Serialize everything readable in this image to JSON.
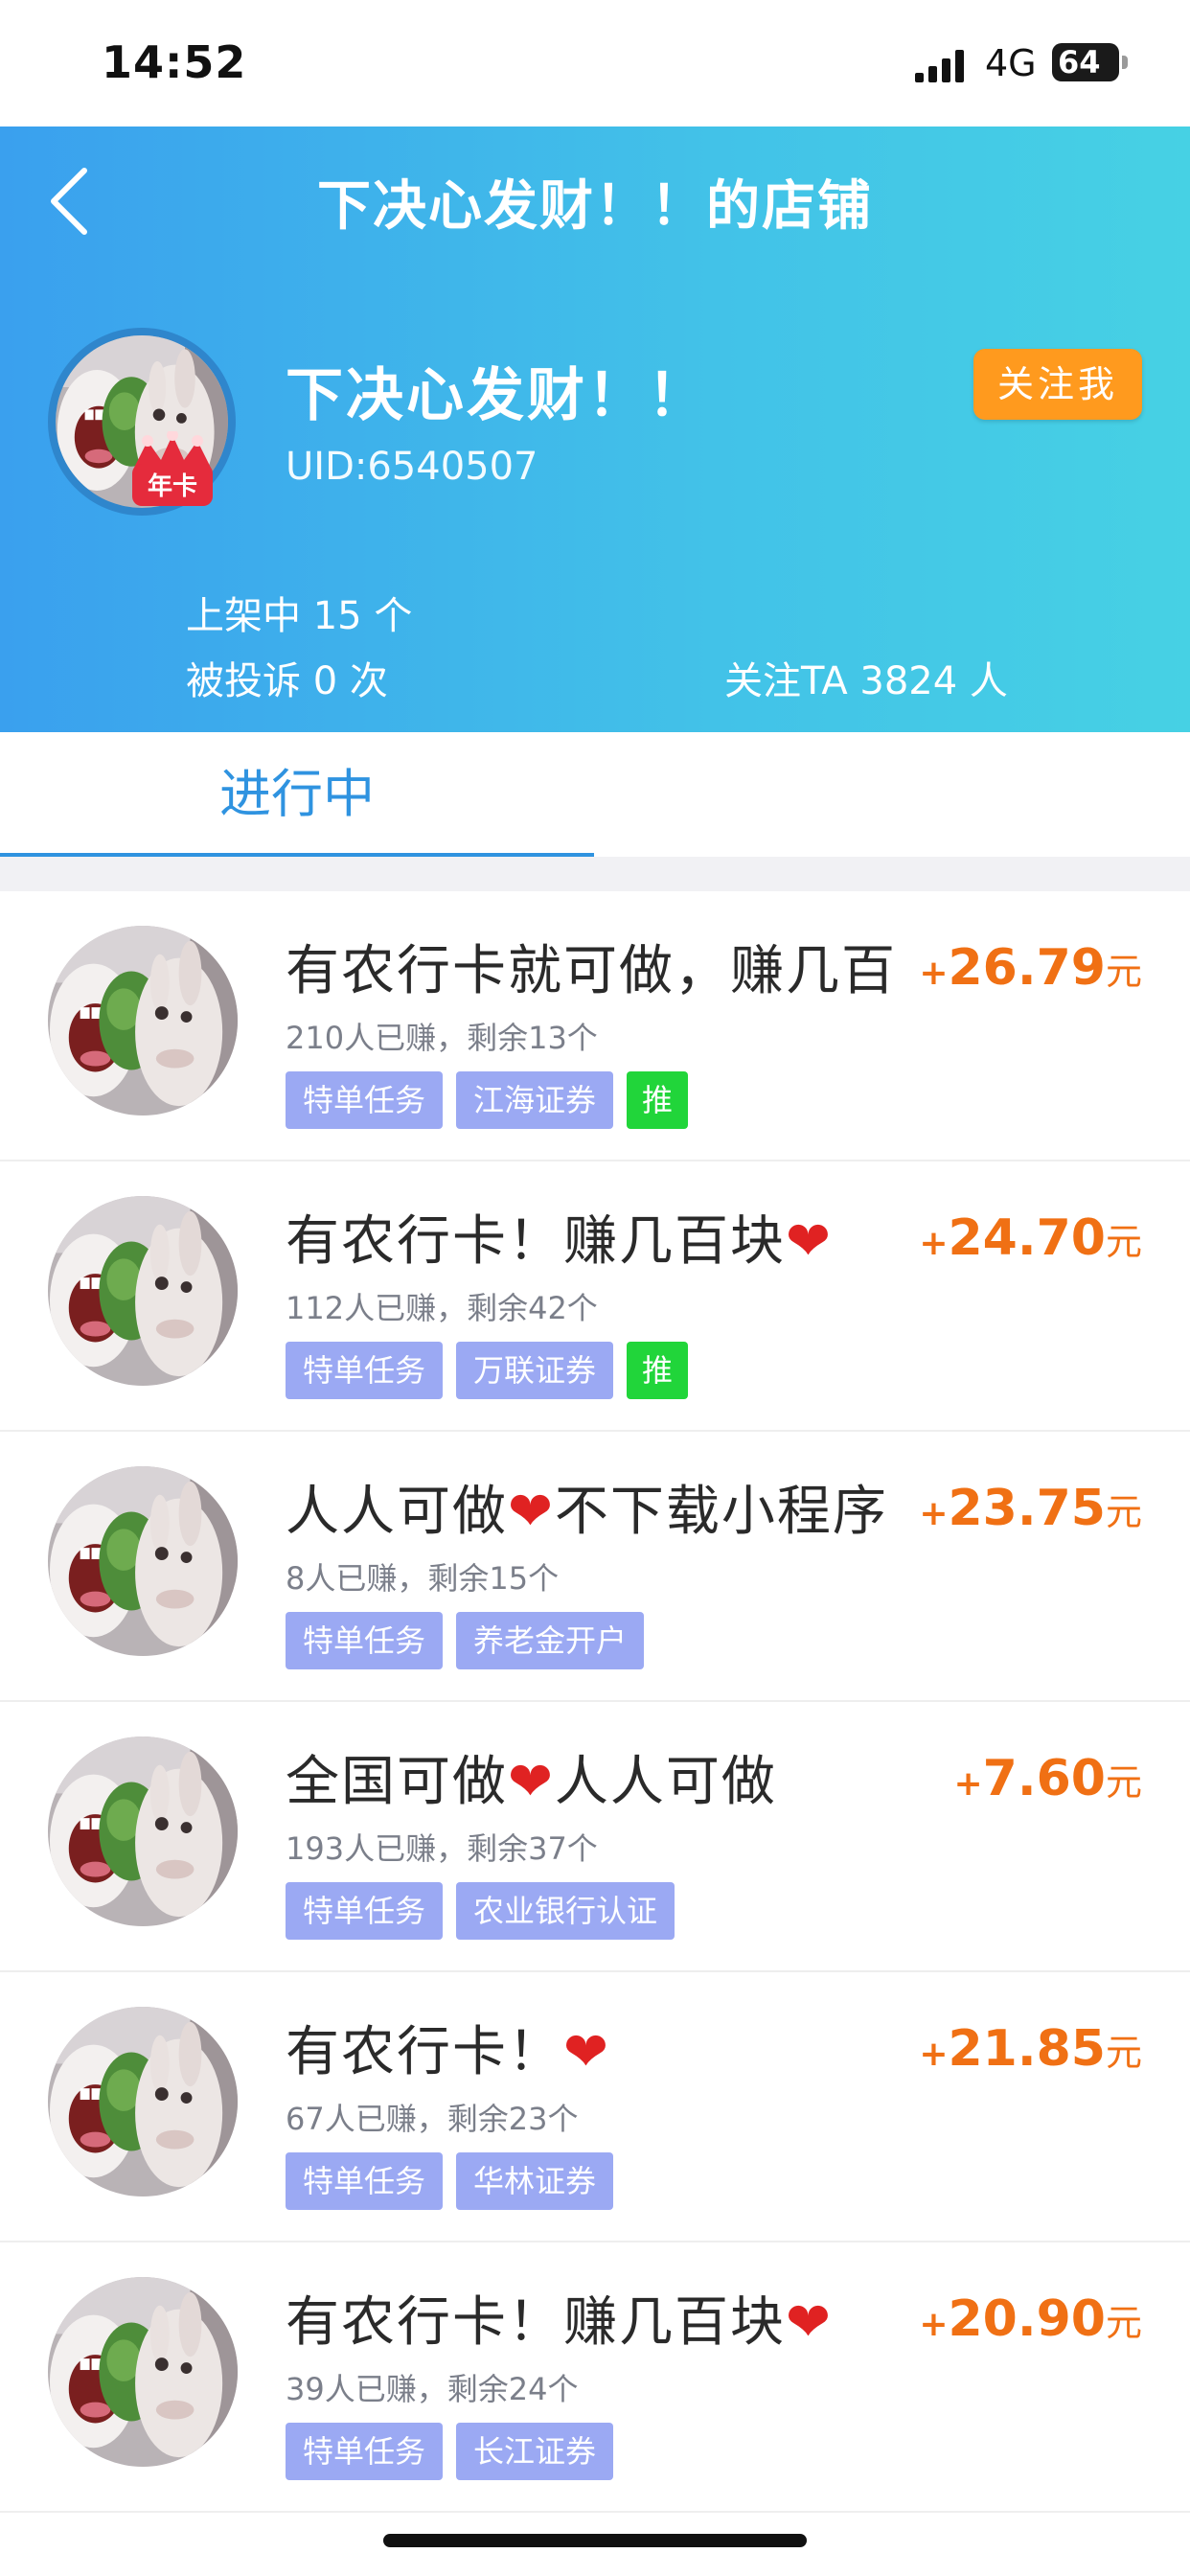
{
  "status_bar": {
    "time": "14:52",
    "network": "4G",
    "battery": "64"
  },
  "header": {
    "title": "下决心发财！！的店铺",
    "back_icon": "chevron-left-icon"
  },
  "shop": {
    "name": "下决心发财！！",
    "uid": "UID:6540507",
    "badge_text": "年卡",
    "follow_button": "关注我",
    "listed": "上架中 15 个",
    "complaints": "被投诉 0 次",
    "followers": "关注TA 3824 人"
  },
  "tabs": {
    "active": "进行中"
  },
  "tasks": [
    {
      "title": "有农行卡就可做，赚几百",
      "meta": "210人已赚，剩余13个",
      "tag1": "特单任务",
      "tag2": "江海证券",
      "push": "推",
      "plus": "+",
      "amount": "26.79",
      "unit": "元"
    },
    {
      "title_a": "有农行卡！赚几百块",
      "title_heart": "❤",
      "title_b": "",
      "meta": "112人已赚，剩余42个",
      "tag1": "特单任务",
      "tag2": "万联证券",
      "push": "推",
      "plus": "+",
      "amount": "24.70",
      "unit": "元"
    },
    {
      "title_a": "人人可做",
      "title_heart": "❤",
      "title_b": "不下载小程序",
      "meta": "8人已赚，剩余15个",
      "tag1": "特单任务",
      "tag2": "养老金开户",
      "plus": "+",
      "amount": "23.75",
      "unit": "元"
    },
    {
      "title_a": "全国可做",
      "title_heart": "❤",
      "title_b": "人人可做",
      "meta": "193人已赚，剩余37个",
      "tag1": "特单任务",
      "tag2": "农业银行认证",
      "plus": "+",
      "amount": "7.60",
      "unit": "元"
    },
    {
      "title_a": "有农行卡！",
      "title_heart": "❤",
      "title_b": "",
      "meta": "67人已赚，剩余23个",
      "tag1": "特单任务",
      "tag2": "华林证券",
      "plus": "+",
      "amount": "21.85",
      "unit": "元"
    },
    {
      "title_a": "有农行卡！赚几百块",
      "title_heart": "❤",
      "title_b": "",
      "meta": "39人已赚，剩余24个",
      "tag1": "特单任务",
      "tag2": "长江证券",
      "plus": "+",
      "amount": "20.90",
      "unit": "元"
    }
  ],
  "colors": {
    "header_gradient_start": "#3aa0ee",
    "header_gradient_end": "#46d1e4",
    "follow_button": "#ff9a1e",
    "reward": "#f07014",
    "tag": "#9ba9f3",
    "push_tag": "#21d53a",
    "tab_active": "#2f93e0"
  }
}
